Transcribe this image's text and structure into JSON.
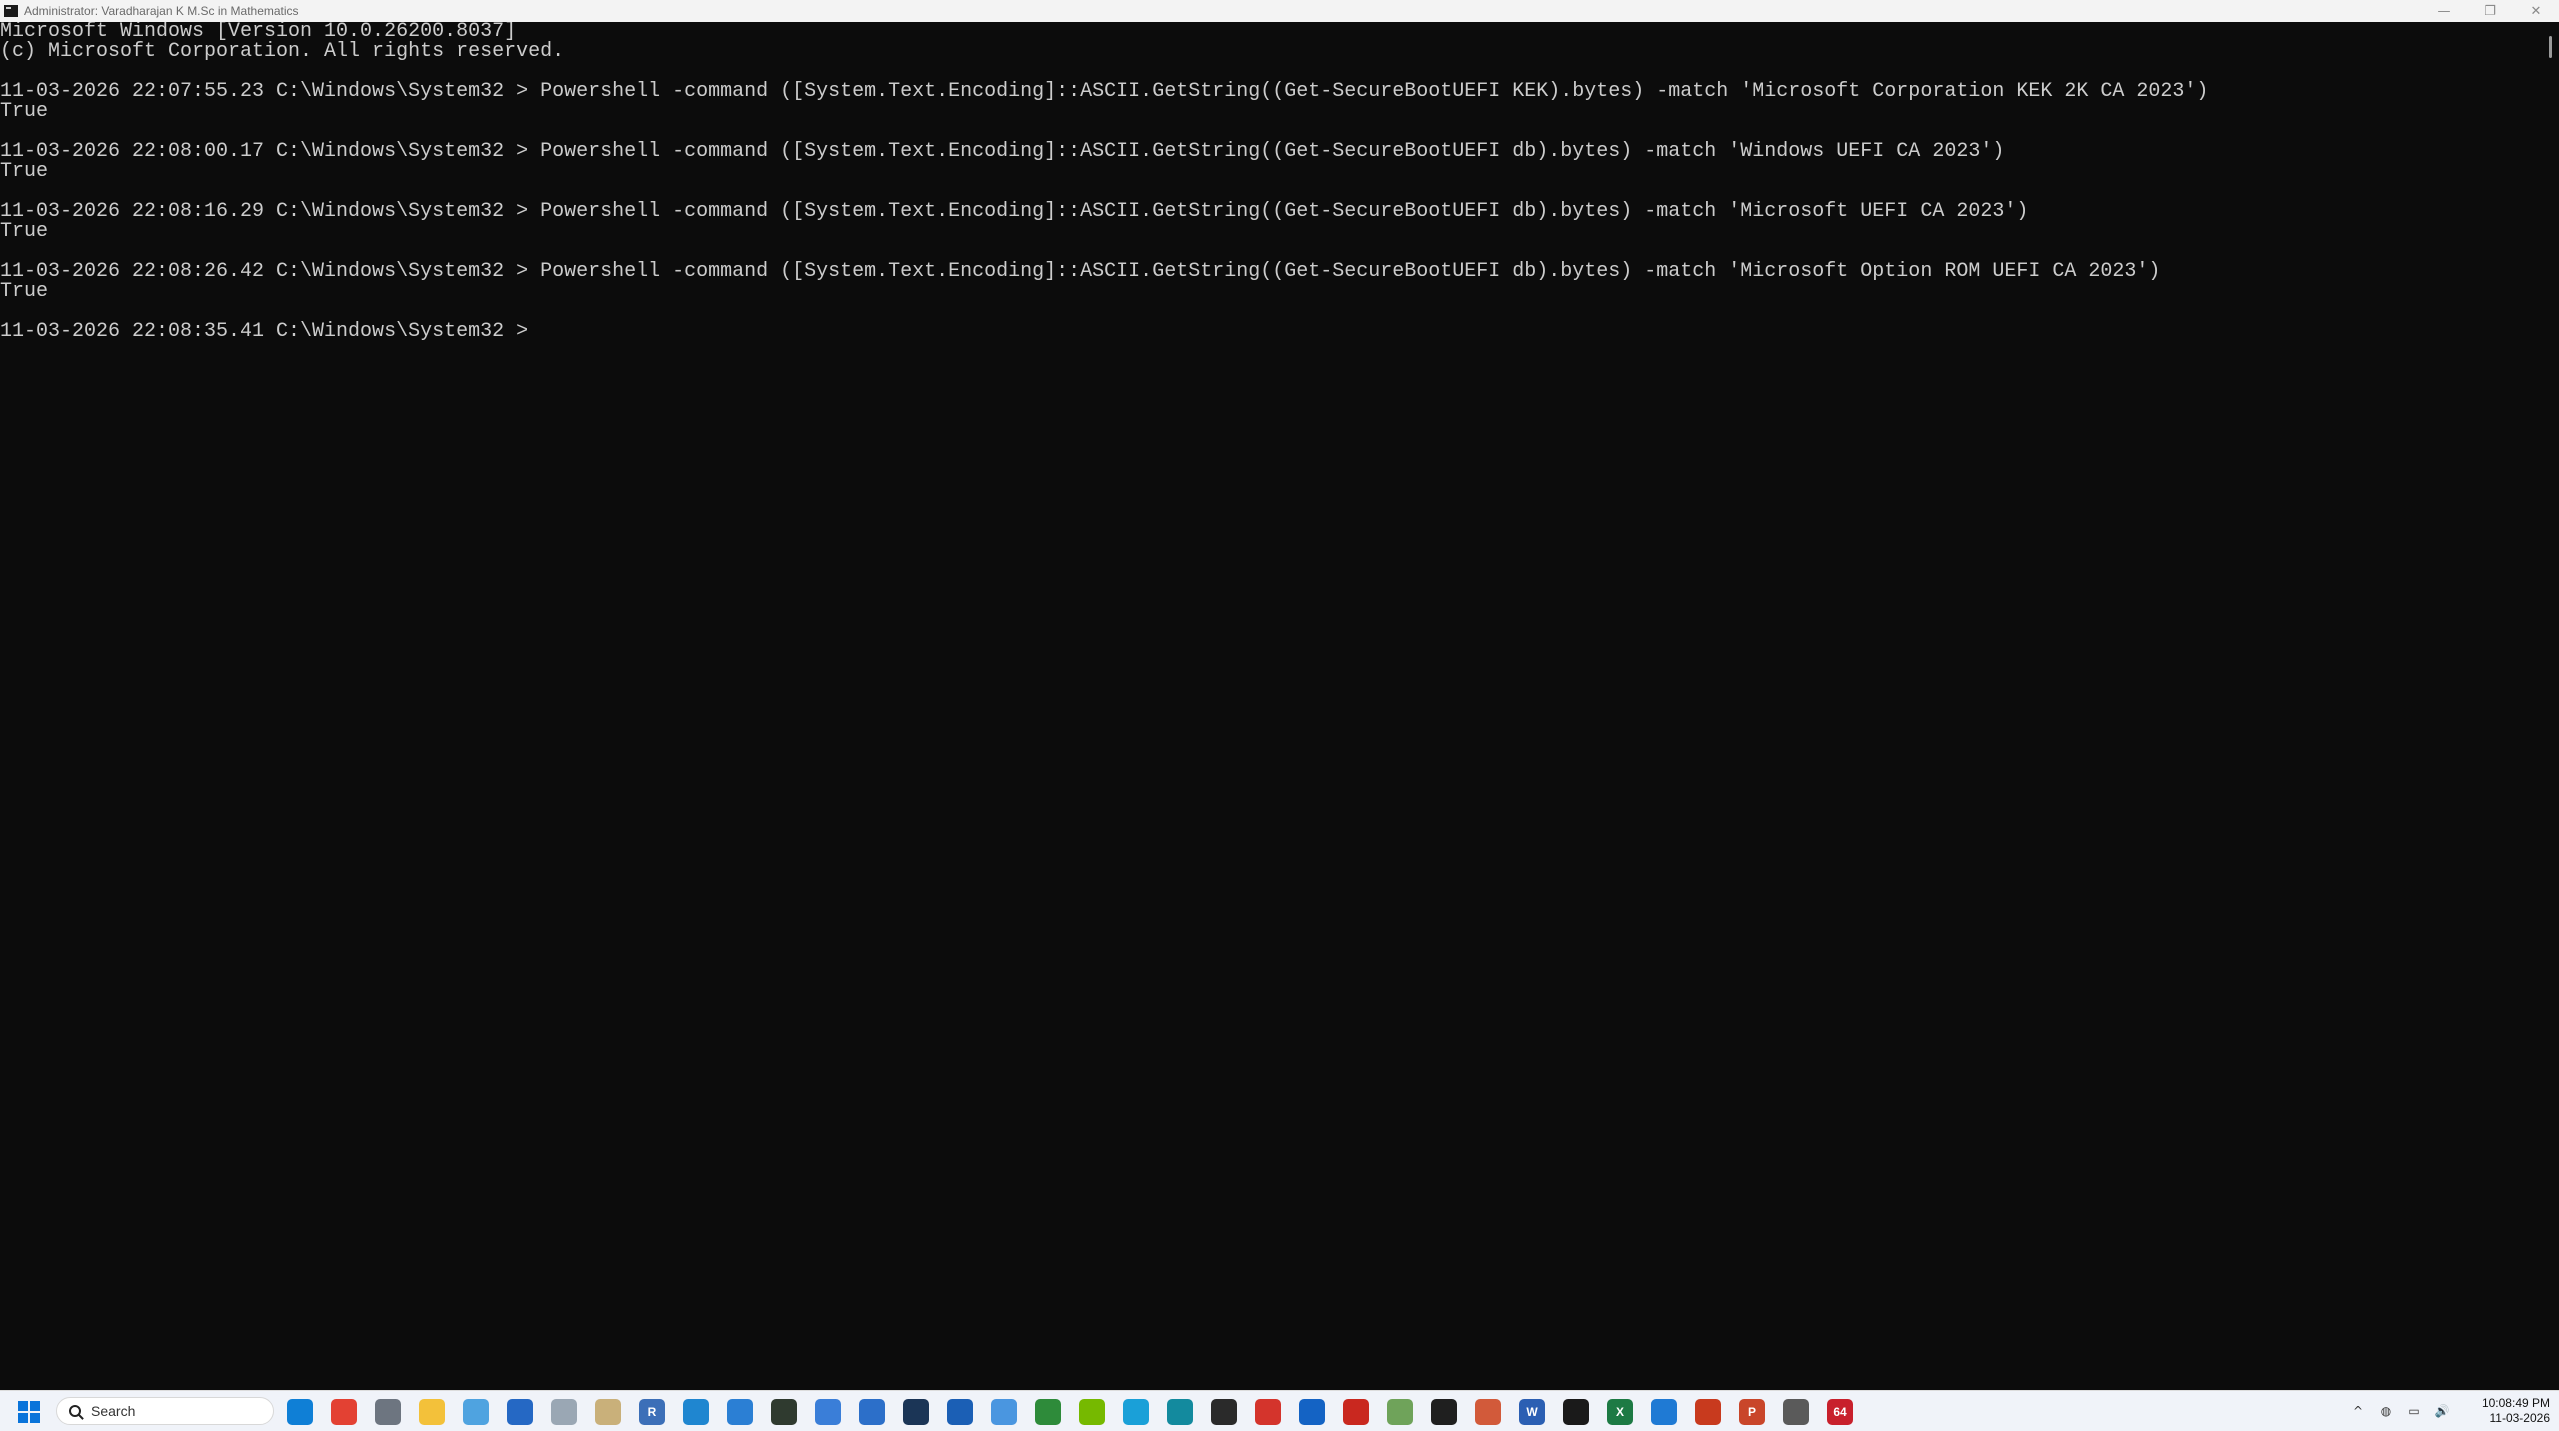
{
  "window": {
    "title": "Administrator: Varadharajan K M.Sc in Mathematics",
    "controls": {
      "minimize": "—",
      "restore": "❐",
      "close": "✕"
    }
  },
  "console": {
    "lines": [
      "Microsoft Windows [Version 10.0.26200.8037]",
      "(c) Microsoft Corporation. All rights reserved.",
      "",
      "11-03-2026 22:07:55.23 C:\\Windows\\System32 > Powershell -command ([System.Text.Encoding]::ASCII.GetString((Get-SecureBootUEFI KEK).bytes) -match 'Microsoft Corporation KEK 2K CA 2023')",
      "True",
      "",
      "11-03-2026 22:08:00.17 C:\\Windows\\System32 > Powershell -command ([System.Text.Encoding]::ASCII.GetString((Get-SecureBootUEFI db).bytes) -match 'Windows UEFI CA 2023')",
      "True",
      "",
      "11-03-2026 22:08:16.29 C:\\Windows\\System32 > Powershell -command ([System.Text.Encoding]::ASCII.GetString((Get-SecureBootUEFI db).bytes) -match 'Microsoft UEFI CA 2023')",
      "True",
      "",
      "11-03-2026 22:08:26.42 C:\\Windows\\System32 > Powershell -command ([System.Text.Encoding]::ASCII.GetString((Get-SecureBootUEFI db).bytes) -match 'Microsoft Option ROM UEFI CA 2023')",
      "True",
      "",
      "11-03-2026 22:08:35.41 C:\\Windows\\System32 >"
    ]
  },
  "taskbar": {
    "search_placeholder": "Search",
    "apps": [
      {
        "name": "edge-icon",
        "color": "#0f7fd6",
        "text": ""
      },
      {
        "name": "chrome-icon",
        "color": "#e34133",
        "text": ""
      },
      {
        "name": "settings-icon",
        "color": "#6d7580",
        "text": ""
      },
      {
        "name": "file-explorer-icon",
        "color": "#f3c13a",
        "text": ""
      },
      {
        "name": "mail-icon",
        "color": "#4fa3e0",
        "text": ""
      },
      {
        "name": "store-icon",
        "color": "#2568c4",
        "text": ""
      },
      {
        "name": "network-icon",
        "color": "#9aa7b4",
        "text": ""
      },
      {
        "name": "clock-app-icon",
        "color": "#c9b07a",
        "text": ""
      },
      {
        "name": "r-app-icon",
        "color": "#3c6fb8",
        "text": "R"
      },
      {
        "name": "photos-icon",
        "color": "#1f86d0",
        "text": ""
      },
      {
        "name": "teams-icon",
        "color": "#2b7fd4",
        "text": ""
      },
      {
        "name": "terminal-icon",
        "color": "#2f3a2f",
        "text": ""
      },
      {
        "name": "notepad-icon",
        "color": "#3a7ed8",
        "text": ""
      },
      {
        "name": "remote-desktop-icon",
        "color": "#2c6fc9",
        "text": ""
      },
      {
        "name": "steam-icon",
        "color": "#1b3556",
        "text": ""
      },
      {
        "name": "hp-app-icon",
        "color": "#1b5fb5",
        "text": ""
      },
      {
        "name": "snipping-tool-icon",
        "color": "#4a96e0",
        "text": ""
      },
      {
        "name": "xbox-icon",
        "color": "#2e8b3a",
        "text": ""
      },
      {
        "name": "nvidia-icon",
        "color": "#76b900",
        "text": ""
      },
      {
        "name": "copilot-icon",
        "color": "#1aa0d8",
        "text": ""
      },
      {
        "name": "hexagon-app-icon",
        "color": "#138a9e",
        "text": ""
      },
      {
        "name": "clapper-icon",
        "color": "#2a2a2a",
        "text": ""
      },
      {
        "name": "maps-pin-icon",
        "color": "#d4342c",
        "text": ""
      },
      {
        "name": "outlook-icon",
        "color": "#1463c4",
        "text": ""
      },
      {
        "name": "flash-icon",
        "color": "#c9281f",
        "text": ""
      },
      {
        "name": "game-controller-icon",
        "color": "#6fa35a",
        "text": ""
      },
      {
        "name": "plex-icon",
        "color": "#1f1f1f",
        "text": ""
      },
      {
        "name": "sync-icon",
        "color": "#d25a3a",
        "text": ""
      },
      {
        "name": "word-icon",
        "color": "#2b5fb3",
        "text": "W"
      },
      {
        "name": "cmd-icon",
        "color": "#1a1a1a",
        "text": ""
      },
      {
        "name": "excel-icon",
        "color": "#1d7a44",
        "text": "X"
      },
      {
        "name": "defender-icon",
        "color": "#1f7ad4",
        "text": ""
      },
      {
        "name": "fire-app-icon",
        "color": "#c83a1e",
        "text": ""
      },
      {
        "name": "powerpoint-icon",
        "color": "#c9462a",
        "text": "P"
      },
      {
        "name": "cpu-monitor-icon",
        "color": "#5a5a5a",
        "text": ""
      },
      {
        "name": "app-64-icon",
        "color": "#c8202c",
        "text": "64"
      }
    ],
    "tray": {
      "chevron": "^",
      "network": "◍",
      "display": "▭",
      "volume": "🔊"
    },
    "time": "10:08:49 PM",
    "date": "11-03-2026"
  }
}
